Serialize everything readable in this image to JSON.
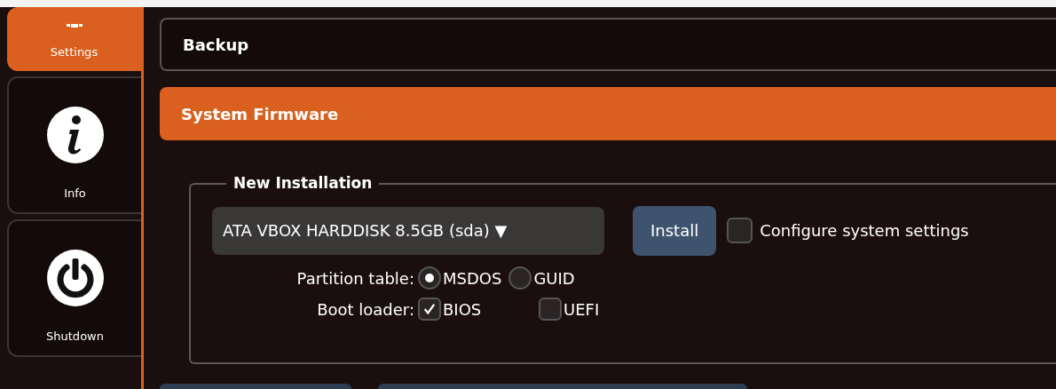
{
  "sidebar": {
    "items": [
      {
        "label": "Settings",
        "kind": "gear",
        "selected": true
      },
      {
        "label": "Info",
        "kind": "info",
        "selected": false
      },
      {
        "label": "Shutdown",
        "kind": "power",
        "selected": false
      }
    ]
  },
  "sections": [
    {
      "title": "Backup",
      "expanded": false
    },
    {
      "title": "System Firmware",
      "expanded": true
    }
  ],
  "new_installation": {
    "legend": "New Installation",
    "disk_select": {
      "value": "ATA VBOX HARDDISK 8.5GB (sda)",
      "arrow": "▼"
    },
    "install_button": "Install",
    "configure": {
      "label": "Configure system settings",
      "checked": false
    },
    "partition_table": {
      "label": "Partition table:",
      "options": [
        {
          "label": "MSDOS",
          "selected": true
        },
        {
          "label": "GUID",
          "selected": false
        }
      ]
    },
    "boot_loader": {
      "label": "Boot loader:",
      "options": [
        {
          "label": "BIOS",
          "checked": true
        },
        {
          "label": "UEFI",
          "checked": false
        }
      ]
    }
  }
}
